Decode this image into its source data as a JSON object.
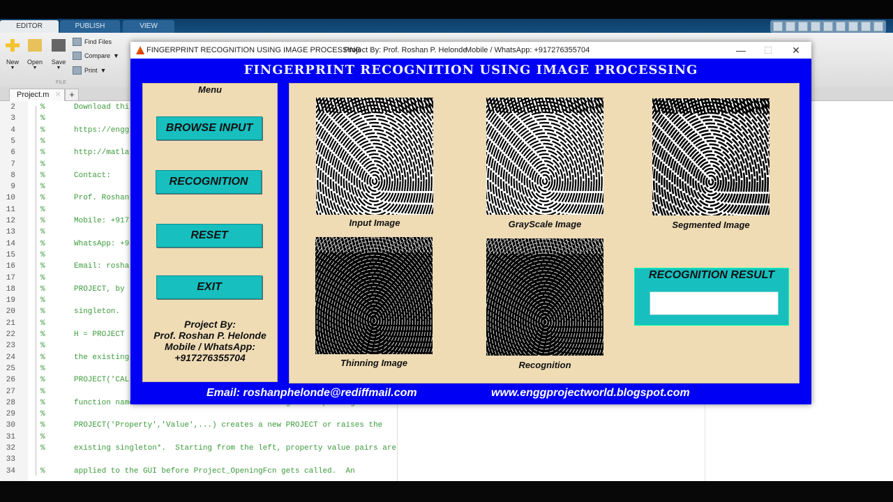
{
  "ribbon": {
    "tabs": [
      {
        "label": "EDITOR",
        "active": true
      },
      {
        "label": "PUBLISH"
      },
      {
        "label": "VIEW"
      }
    ],
    "buttons": {
      "new": "New",
      "open": "Open",
      "save": "Save",
      "find_files": "Find Files",
      "compare": "Compare",
      "print": "Print"
    },
    "section_label": "FILE"
  },
  "editor": {
    "file_tab": "Project.m",
    "lines": [
      {
        "n": "2",
        "pct": "%",
        "text": "Download thi"
      },
      {
        "n": "3",
        "pct": "%",
        "text": ""
      },
      {
        "n": "4",
        "pct": "%",
        "text": "https://engg"
      },
      {
        "n": "5",
        "pct": "%",
        "text": ""
      },
      {
        "n": "6",
        "pct": "%",
        "text": "http://matla"
      },
      {
        "n": "7",
        "pct": "%",
        "text": ""
      },
      {
        "n": "8",
        "pct": "%",
        "text": "Contact:"
      },
      {
        "n": "9",
        "pct": "%",
        "text": ""
      },
      {
        "n": "10",
        "pct": "%",
        "text": "Prof. Roshan"
      },
      {
        "n": "11",
        "pct": "%",
        "text": ""
      },
      {
        "n": "12",
        "pct": "%",
        "text": "Mobile: +917"
      },
      {
        "n": "13",
        "pct": "%",
        "text": ""
      },
      {
        "n": "14",
        "pct": "%",
        "text": "WhatsApp: +9"
      },
      {
        "n": "15",
        "pct": "%",
        "text": ""
      },
      {
        "n": "16",
        "pct": "%",
        "text": "Email: rosha"
      },
      {
        "n": "17",
        "pct": "%",
        "text": ""
      },
      {
        "n": "18",
        "pct": "%",
        "text": "PROJECT, by"
      },
      {
        "n": "19",
        "pct": "%",
        "text": ""
      },
      {
        "n": "20",
        "pct": "%",
        "text": "singleton."
      },
      {
        "n": "21",
        "pct": "%",
        "text": ""
      },
      {
        "n": "22",
        "pct": "%",
        "text": "H = PROJECT"
      },
      {
        "n": "23",
        "pct": "%",
        "text": ""
      },
      {
        "n": "24",
        "pct": "%",
        "text": "the existing"
      },
      {
        "n": "25",
        "pct": "%",
        "text": ""
      },
      {
        "n": "26",
        "pct": "%",
        "text": "PROJECT('CAL"
      },
      {
        "n": "27",
        "pct": "%",
        "text": ""
      },
      {
        "n": "28",
        "pct": "%",
        "text": "function named CALLBACK in PROJECT.M with the given input arguments."
      },
      {
        "n": "29",
        "pct": "%",
        "text": ""
      },
      {
        "n": "30",
        "pct": "%",
        "text": "PROJECT('Property','Value',...) creates a new PROJECT or raises the"
      },
      {
        "n": "31",
        "pct": "%",
        "text": ""
      },
      {
        "n": "32",
        "pct": "%",
        "text": "existing singleton*.  Starting from the left, property value pairs are"
      },
      {
        "n": "33",
        "pct": "",
        "text": ""
      },
      {
        "n": "34",
        "pct": "%",
        "text": "applied to the GUI before Project_OpeningFcn gets called.  An"
      }
    ]
  },
  "figure": {
    "window_title": "FINGERPRINT RECOGNITION USING IMAGE PROCESSING",
    "window_project": "Project By: Prof. Roshan P. Helonde",
    "window_mobile": "Mobile / WhatsApp: +917276355704",
    "controls": {
      "minimize": "—",
      "maximize": "☐",
      "close": "✕"
    },
    "app_title": "FINGERPRINT RECOGNITION USING IMAGE PROCESSING",
    "menu": {
      "label": "Menu",
      "buttons": [
        "BROWSE INPUT",
        "RECOGNITION",
        "RESET",
        "EXIT"
      ],
      "credits": [
        "Project By:",
        "Prof. Roshan P. Helonde",
        "Mobile / WhatsApp:",
        "+917276355704"
      ]
    },
    "images": [
      {
        "caption": "Input Image",
        "style": "light"
      },
      {
        "caption": "GrayScale Image",
        "style": "light"
      },
      {
        "caption": "Segmented Image",
        "style": "light"
      },
      {
        "caption": "Thinning Image",
        "style": "dark"
      },
      {
        "caption": "Recognition",
        "style": "dark"
      }
    ],
    "result": {
      "label": "RECOGNITION RESULT",
      "value": ""
    },
    "footer": {
      "email": "Email: roshanphelonde@rediffmail.com",
      "website": "www.enggprojectworld.blogspot.com"
    },
    "colors": {
      "background": "#0000f5",
      "panel": "#efdcb5",
      "button": "#17bfbf"
    }
  }
}
